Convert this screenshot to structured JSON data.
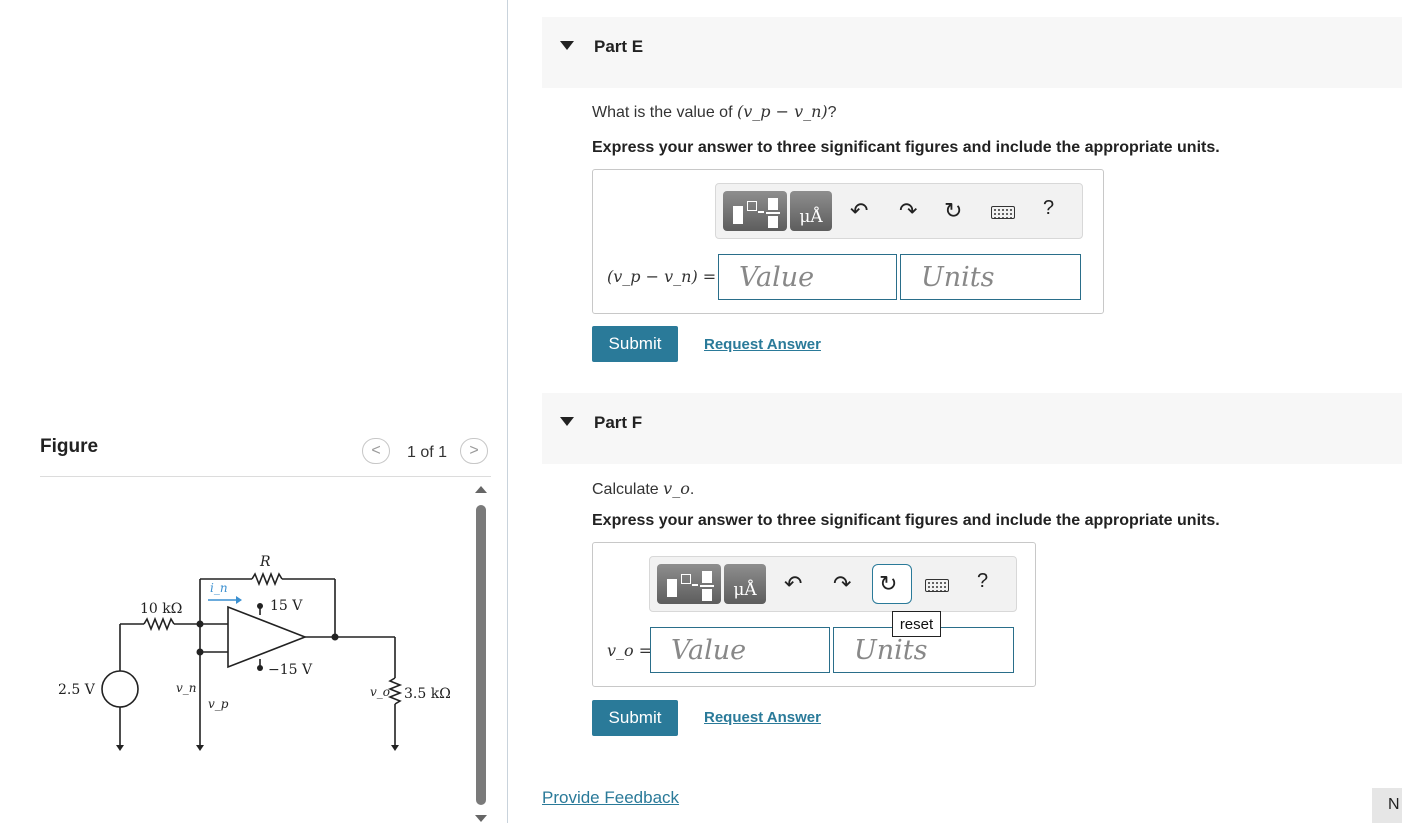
{
  "figure": {
    "title": "Figure",
    "pager_text": "1 of 1",
    "prev_icon": "chevron-left-icon",
    "next_icon": "chevron-right-icon",
    "labels": {
      "r_label": "R",
      "in_label": "i_n",
      "r10k": "10 kΩ",
      "v15": "15 V",
      "vneg15": "−15 V",
      "v25": "2.5 V",
      "vn": "v_n",
      "vp": "v_p",
      "vo": "v_o",
      "r35k": "3.5 kΩ"
    }
  },
  "part_e": {
    "label": "Part E",
    "question_prefix": "What is the value of ",
    "question_math": "(v_p − v_n)",
    "question_suffix": "?",
    "instruction": "Express your answer to three significant figures and include the appropriate units.",
    "eq_label": "(v_p − v_n) =",
    "value_placeholder": "Value",
    "units_placeholder": "Units",
    "submit_label": "Submit",
    "request_label": "Request Answer"
  },
  "part_f": {
    "label": "Part F",
    "question_prefix": "Calculate ",
    "question_math": "v_o",
    "question_suffix": ".",
    "instruction": "Express your answer to three significant figures and include the appropriate units.",
    "eq_label": "v_o =",
    "value_placeholder": "Value",
    "units_placeholder": "Units",
    "submit_label": "Submit",
    "request_label": "Request Answer",
    "tooltip": "reset"
  },
  "toolbar": {
    "mu_label": "μÅ",
    "help_label": "?"
  },
  "feedback_label": "Provide Feedback",
  "next_label": "N"
}
